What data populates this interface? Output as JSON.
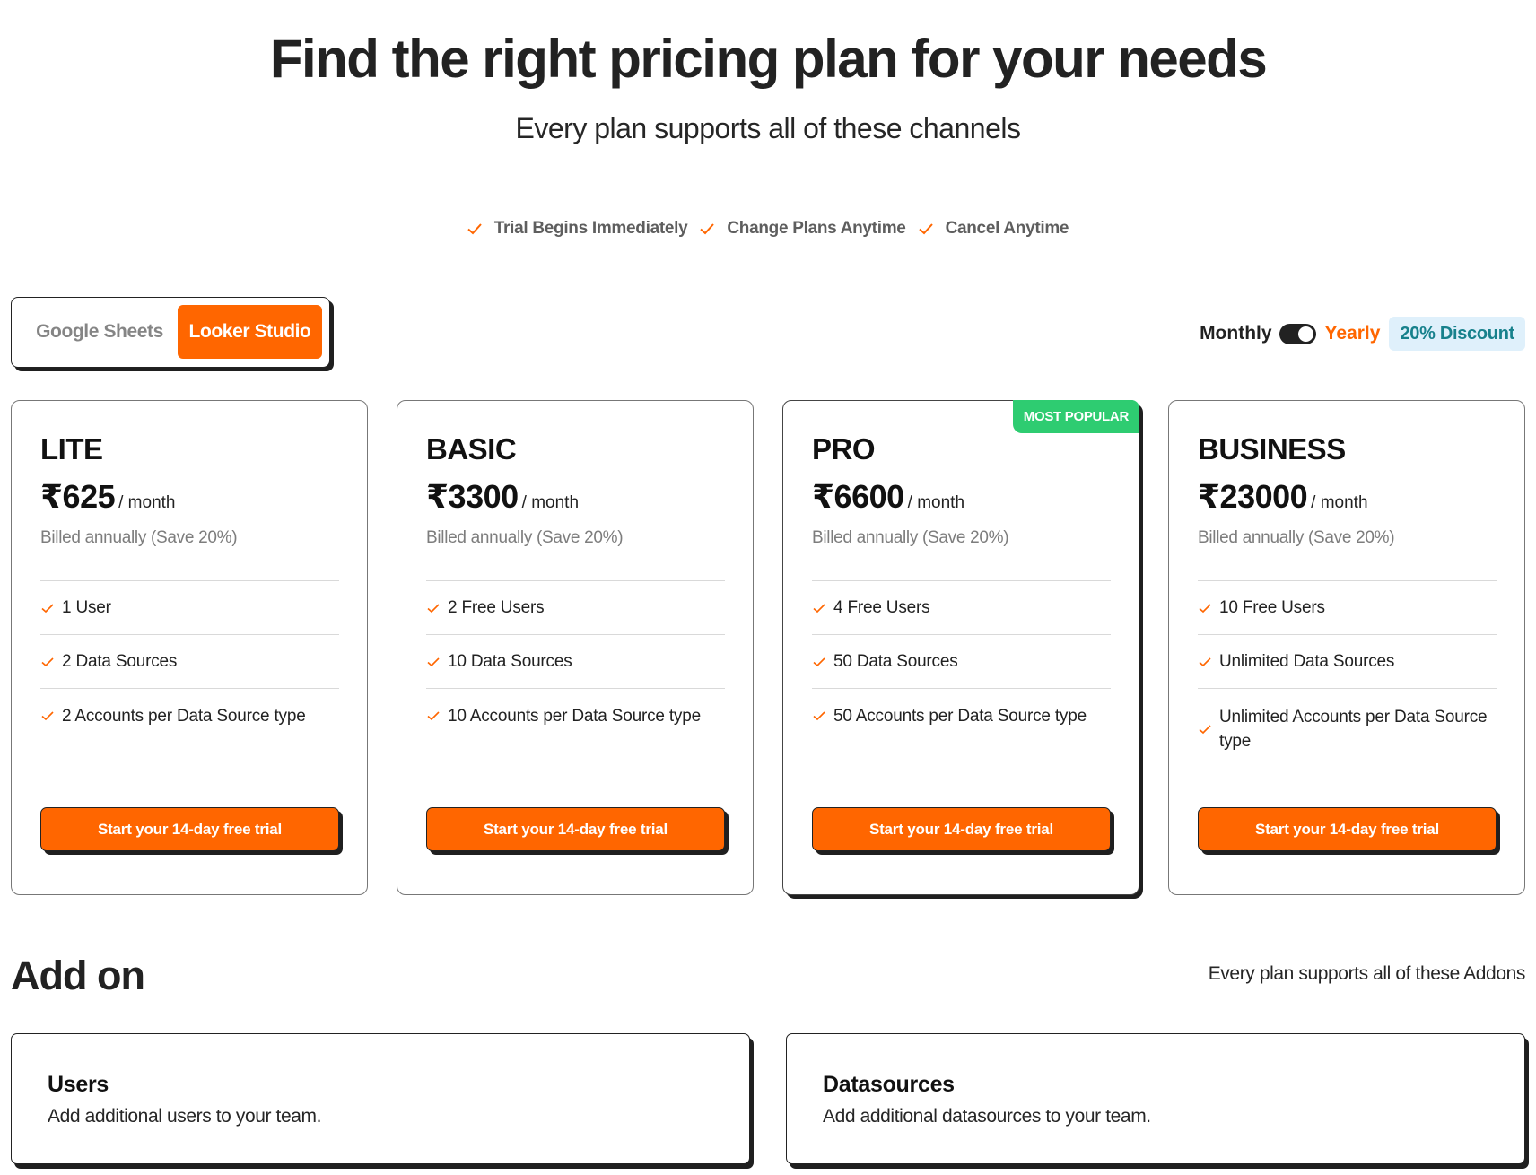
{
  "header": {
    "title": "Find the right pricing plan for your needs",
    "subtitle": "Every plan supports all of these channels"
  },
  "trust": [
    {
      "icon": "check-icon",
      "label": "Trial Begins Immediately"
    },
    {
      "icon": "check-icon",
      "label": "Change Plans Anytime"
    },
    {
      "icon": "check-icon",
      "label": "Cancel Anytime"
    }
  ],
  "channels": {
    "options": [
      "Google Sheets",
      "Looker Studio"
    ],
    "selected": "Looker Studio"
  },
  "billing": {
    "monthly_label": "Monthly",
    "yearly_label": "Yearly",
    "selected": "Yearly",
    "discount_badge": "20% Discount"
  },
  "plans": [
    {
      "name": "LITE",
      "price": "₹625",
      "period": "/ month",
      "billing_note": "Billed annually (Save 20%)",
      "features": [
        "1 User",
        "2 Data Sources",
        "2 Accounts per Data Source type"
      ],
      "cta": "Start your 14-day free trial"
    },
    {
      "name": "BASIC",
      "price": "₹3300",
      "period": "/ month",
      "billing_note": "Billed annually (Save 20%)",
      "features": [
        "2 Free Users",
        "10 Data Sources",
        "10 Accounts per Data Source type"
      ],
      "cta": "Start your 14-day free trial"
    },
    {
      "name": "PRO",
      "price": "₹6600",
      "period": "/ month",
      "billing_note": "Billed annually (Save 20%)",
      "features": [
        "4 Free Users",
        "50 Data Sources",
        "50 Accounts per Data Source type"
      ],
      "cta": "Start your 14-day free trial",
      "badge": "MOST POPULAR"
    },
    {
      "name": "BUSINESS",
      "price": "₹23000",
      "period": "/ month",
      "billing_note": "Billed annually (Save 20%)",
      "features": [
        "10 Free Users",
        "Unlimited Data Sources",
        "Unlimited Accounts per Data Source type"
      ],
      "cta": "Start your 14-day free trial"
    }
  ],
  "addons": {
    "title": "Add on",
    "subtitle": "Every plan supports all of these Addons",
    "items": [
      {
        "name": "Users",
        "description": "Add additional users to your team."
      },
      {
        "name": "Datasources",
        "description": "Add additional datasources to your team."
      }
    ]
  },
  "colors": {
    "accent": "#ff6600",
    "popular": "#2ecc71",
    "discount_bg": "#dff0fb",
    "discount_text": "#17818c"
  }
}
